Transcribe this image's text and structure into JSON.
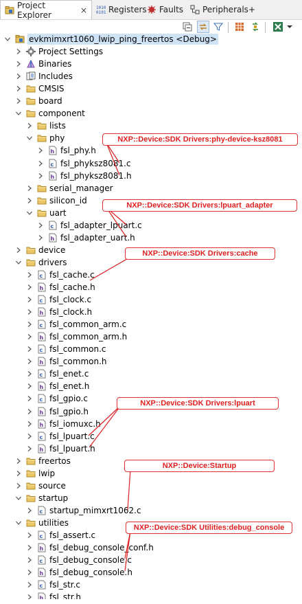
{
  "tabs": [
    {
      "label": "Project Explorer",
      "icon": "project-explorer-icon",
      "active": true
    },
    {
      "label": "Registers",
      "icon": "registers-icon"
    },
    {
      "label": "Faults",
      "icon": "faults-icon"
    },
    {
      "label": "Peripherals+",
      "icon": "peripherals-icon"
    }
  ],
  "tab_close": "×",
  "tree": [
    {
      "label": "evkmimxrt1060_lwip_ping_freertos <Debug>",
      "kind": "project",
      "exp": "open",
      "selected": true
    },
    {
      "label": "Project Settings",
      "kind": "settings",
      "exp": "closed"
    },
    {
      "label": "Binaries",
      "kind": "binaries",
      "exp": "closed"
    },
    {
      "label": "Includes",
      "kind": "includes",
      "exp": "closed"
    },
    {
      "label": "CMSIS",
      "kind": "folder",
      "exp": "closed"
    },
    {
      "label": "board",
      "kind": "folder",
      "exp": "closed"
    },
    {
      "label": "component",
      "kind": "folder",
      "exp": "open"
    },
    {
      "label": "lists",
      "kind": "folder",
      "exp": "closed"
    },
    {
      "label": "phy",
      "kind": "folder",
      "exp": "open"
    },
    {
      "label": "fsl_phy.h",
      "kind": "h",
      "exp": "closed"
    },
    {
      "label": "fsl_phyksz8081.c",
      "kind": "c",
      "exp": "closed"
    },
    {
      "label": "fsl_phyksz8081.h",
      "kind": "h",
      "exp": "closed"
    },
    {
      "label": "serial_manager",
      "kind": "folder",
      "exp": "closed"
    },
    {
      "label": "silicon_id",
      "kind": "folder",
      "exp": "closed"
    },
    {
      "label": "uart",
      "kind": "folder",
      "exp": "open"
    },
    {
      "label": "fsl_adapter_lpuart.c",
      "kind": "c",
      "exp": "closed"
    },
    {
      "label": "fsl_adapter_uart.h",
      "kind": "h",
      "exp": "closed"
    },
    {
      "label": "device",
      "kind": "folder",
      "exp": "closed"
    },
    {
      "label": "drivers",
      "kind": "folder",
      "exp": "open"
    },
    {
      "label": "fsl_cache.c",
      "kind": "c",
      "exp": "closed"
    },
    {
      "label": "fsl_cache.h",
      "kind": "h",
      "exp": "closed"
    },
    {
      "label": "fsl_clock.c",
      "kind": "c",
      "exp": "closed"
    },
    {
      "label": "fsl_clock.h",
      "kind": "h",
      "exp": "closed"
    },
    {
      "label": "fsl_common_arm.c",
      "kind": "c",
      "exp": "closed"
    },
    {
      "label": "fsl_common_arm.h",
      "kind": "h",
      "exp": "closed"
    },
    {
      "label": "fsl_common.c",
      "kind": "c",
      "exp": "closed"
    },
    {
      "label": "fsl_common.h",
      "kind": "h",
      "exp": "closed"
    },
    {
      "label": "fsl_enet.c",
      "kind": "c",
      "exp": "closed"
    },
    {
      "label": "fsl_enet.h",
      "kind": "h",
      "exp": "closed"
    },
    {
      "label": "fsl_gpio.c",
      "kind": "c",
      "exp": "closed"
    },
    {
      "label": "fsl_gpio.h",
      "kind": "h",
      "exp": "closed"
    },
    {
      "label": "fsl_iomuxc.h",
      "kind": "h",
      "exp": "closed"
    },
    {
      "label": "fsl_lpuart.c",
      "kind": "c",
      "exp": "closed"
    },
    {
      "label": "fsl_lpuart.h",
      "kind": "h",
      "exp": "closed"
    },
    {
      "label": "freertos",
      "kind": "folder",
      "exp": "closed"
    },
    {
      "label": "lwip",
      "kind": "folder",
      "exp": "closed"
    },
    {
      "label": "source",
      "kind": "folder",
      "exp": "closed"
    },
    {
      "label": "startup",
      "kind": "folder",
      "exp": "open"
    },
    {
      "label": "startup_mimxrt1062.c",
      "kind": "c",
      "exp": "closed"
    },
    {
      "label": "utilities",
      "kind": "folder",
      "exp": "open"
    },
    {
      "label": "fsl_assert.c",
      "kind": "c",
      "exp": "closed"
    },
    {
      "label": "fsl_debug_console_conf.h",
      "kind": "h",
      "exp": "closed"
    },
    {
      "label": "fsl_debug_console.c",
      "kind": "c",
      "exp": "closed"
    },
    {
      "label": "fsl_debug_console.h",
      "kind": "h",
      "exp": "closed"
    },
    {
      "label": "fsl_str.c",
      "kind": "c",
      "exp": "closed"
    },
    {
      "label": "fsl_str.h",
      "kind": "h",
      "exp": "closed"
    }
  ],
  "callouts": [
    {
      "text": "NXP::Device:SDK Drivers:phy-device-ksz8081"
    },
    {
      "text": "NXP::Device:SDK Drivers:lpuart_adapter"
    },
    {
      "text": "NXP::Device:SDK Drivers:cache"
    },
    {
      "text": "NXP::Device:SDK Drivers:lpuart"
    },
    {
      "text": "NXP::Device:Startup"
    },
    {
      "text": "NXP::Device:SDK Utilities:debug_console"
    }
  ],
  "colors": {
    "callout_red": "#e02020",
    "folder_yellow": "#e8c460",
    "selection": "#cfe3f7"
  }
}
